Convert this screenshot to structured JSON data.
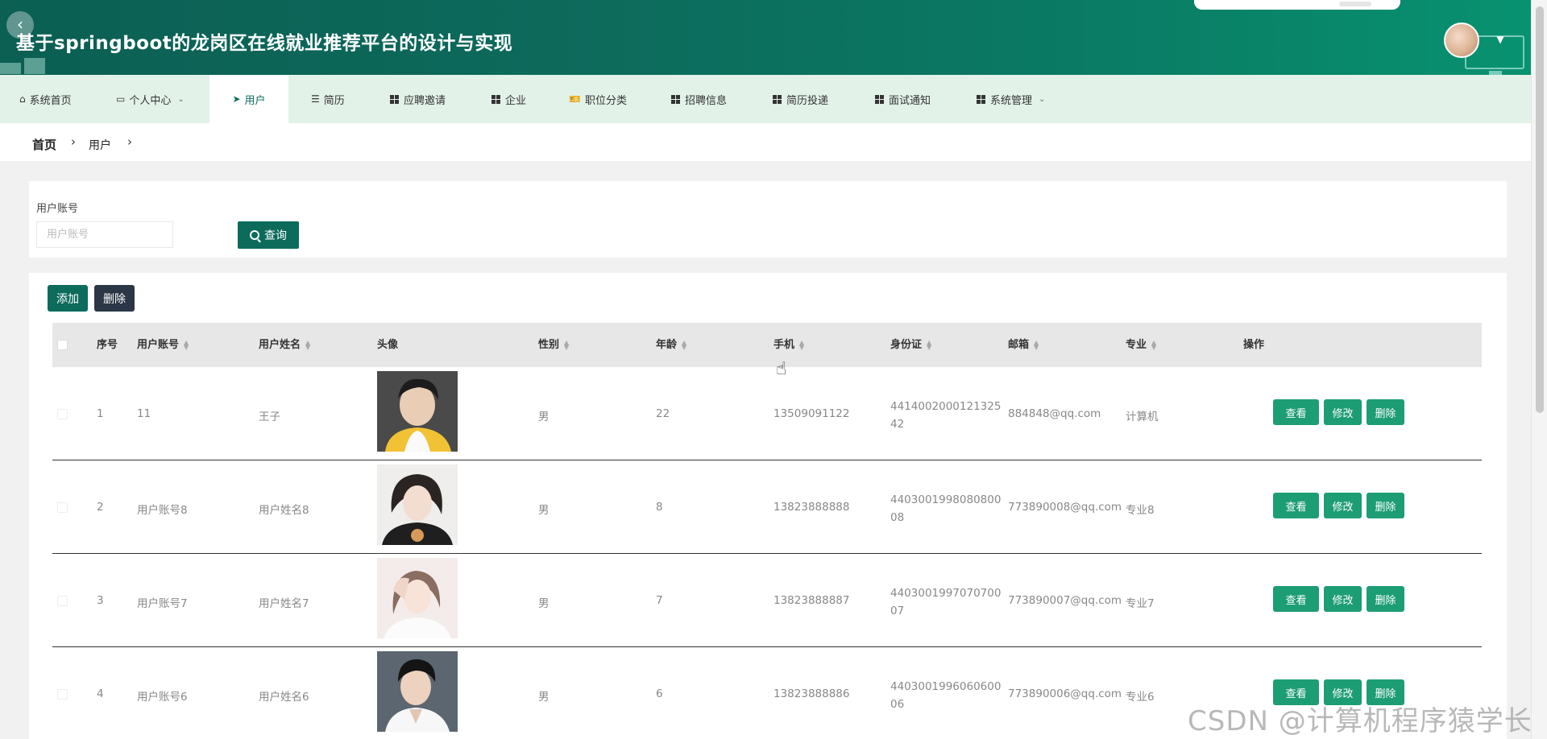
{
  "header": {
    "title": "基于springboot的龙岗区在线就业推荐平台的设计与实现",
    "back_icon": "back-icon",
    "avatar_icon": "user-avatar",
    "accent": "#0c6b5b"
  },
  "nav": {
    "items": [
      {
        "label": "系统首页",
        "icon": "home-icon"
      },
      {
        "label": "个人中心",
        "icon": "profile-icon",
        "dropdown": true
      },
      {
        "label": "用户",
        "icon": "send-icon",
        "active": true
      },
      {
        "label": "简历",
        "icon": "list-icon"
      },
      {
        "label": "应聘邀请",
        "icon": "grid-icon"
      },
      {
        "label": "企业",
        "icon": "grid-icon"
      },
      {
        "label": "职位分类",
        "icon": "ticket-icon"
      },
      {
        "label": "招聘信息",
        "icon": "grid-icon"
      },
      {
        "label": "简历投递",
        "icon": "grid-icon"
      },
      {
        "label": "面试通知",
        "icon": "grid-icon"
      },
      {
        "label": "系统管理",
        "icon": "grid-icon",
        "dropdown": true
      }
    ]
  },
  "breadcrumb": [
    "首页",
    "用户"
  ],
  "search": {
    "label": "用户账号",
    "placeholder": "用户账号",
    "button": "查询"
  },
  "toolbar": {
    "add": "添加",
    "delete": "删除"
  },
  "table": {
    "columns": [
      "序号",
      "用户账号",
      "用户姓名",
      "头像",
      "性别",
      "年龄",
      "手机",
      "身份证",
      "邮箱",
      "专业",
      "操作"
    ],
    "rows": [
      {
        "index": "1",
        "account": "11",
        "name": "王子",
        "gender": "男",
        "age": "22",
        "phone": "13509091122",
        "id_card": "441400200012132542",
        "email": "884848@qq.com",
        "major": "计算机"
      },
      {
        "index": "2",
        "account": "用户账号8",
        "name": "用户姓名8",
        "gender": "男",
        "age": "8",
        "phone": "13823888888",
        "id_card": "440300199808080008",
        "email": "773890008@qq.com",
        "major": "专业8"
      },
      {
        "index": "3",
        "account": "用户账号7",
        "name": "用户姓名7",
        "gender": "男",
        "age": "7",
        "phone": "13823888887",
        "id_card": "440300199707070007",
        "email": "773890007@qq.com",
        "major": "专业7"
      },
      {
        "index": "4",
        "account": "用户账号6",
        "name": "用户姓名6",
        "gender": "男",
        "age": "6",
        "phone": "13823888886",
        "id_card": "440300199606060006",
        "email": "773890006@qq.com",
        "major": "专业6"
      }
    ],
    "actions": {
      "view": "查看",
      "edit": "修改",
      "delete": "删除"
    }
  },
  "watermark": "CSDN @计算机程序猿学长",
  "colors": {
    "primary": "#0c6b5b",
    "action": "#1d9d74",
    "danger_dark": "#2b3646",
    "nav_bg": "#e3f2e9"
  }
}
